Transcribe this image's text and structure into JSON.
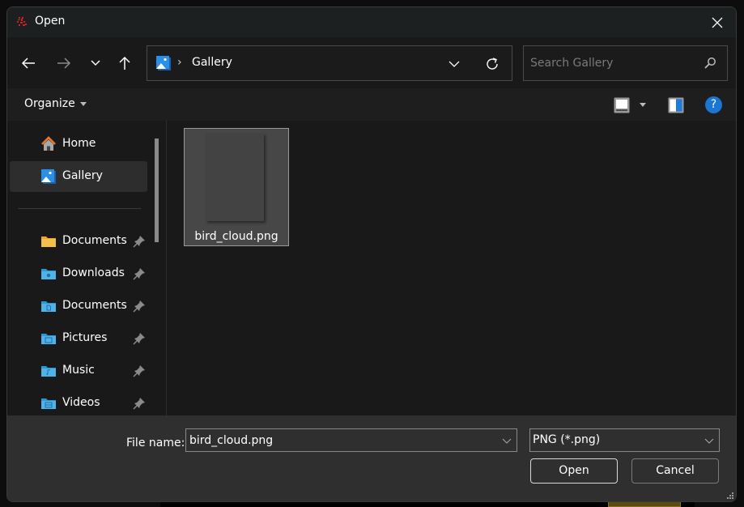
{
  "window": {
    "title": "Open",
    "app_icon": "app-icon",
    "close_icon": "close-icon"
  },
  "nav": {
    "back_icon": "arrow-left-icon",
    "forward_icon": "arrow-right-icon",
    "recent_icon": "chevron-down-icon",
    "up_icon": "arrow-up-icon",
    "address": {
      "location_icon": "gallery-icon",
      "separator": "›",
      "path": "Gallery",
      "dropdown_icon": "chevron-down-icon",
      "refresh_icon": "refresh-icon"
    },
    "search": {
      "placeholder": "Search Gallery",
      "value": "",
      "icon": "search-icon"
    }
  },
  "command_bar": {
    "organize_label": "Organize",
    "view_icon": "view-mode-icon",
    "preview_icon": "preview-pane-icon",
    "help_label": "?"
  },
  "sidebar": {
    "items": [
      {
        "label": "Home",
        "icon": "home-icon",
        "selected": false,
        "pinned": false
      },
      {
        "label": "Gallery",
        "icon": "gallery-icon",
        "selected": true,
        "pinned": false
      },
      {
        "label": "Documents",
        "icon": "folder-icon",
        "selected": false,
        "pinned": true
      },
      {
        "label": "Downloads",
        "icon": "downloads-folder-icon",
        "selected": false,
        "pinned": true
      },
      {
        "label": "Documents",
        "icon": "documents-folder-icon",
        "selected": false,
        "pinned": true
      },
      {
        "label": "Pictures",
        "icon": "pictures-folder-icon",
        "selected": false,
        "pinned": true
      },
      {
        "label": "Music",
        "icon": "music-folder-icon",
        "selected": false,
        "pinned": true
      },
      {
        "label": "Videos",
        "icon": "videos-folder-icon",
        "selected": false,
        "pinned": true
      }
    ]
  },
  "files": [
    {
      "name": "bird_cloud.png",
      "selected": true
    }
  ],
  "footer": {
    "file_name_label": "File name:",
    "file_name_value": "bird_cloud.png",
    "file_type": "PNG (*.png)",
    "open_label": "Open",
    "cancel_label": "Cancel"
  },
  "colors": {
    "accent": "#1976d2",
    "folder_blue": "#4fb3e8",
    "folder_yellow": "#f5c04a",
    "home_orange": "#e8782a"
  }
}
